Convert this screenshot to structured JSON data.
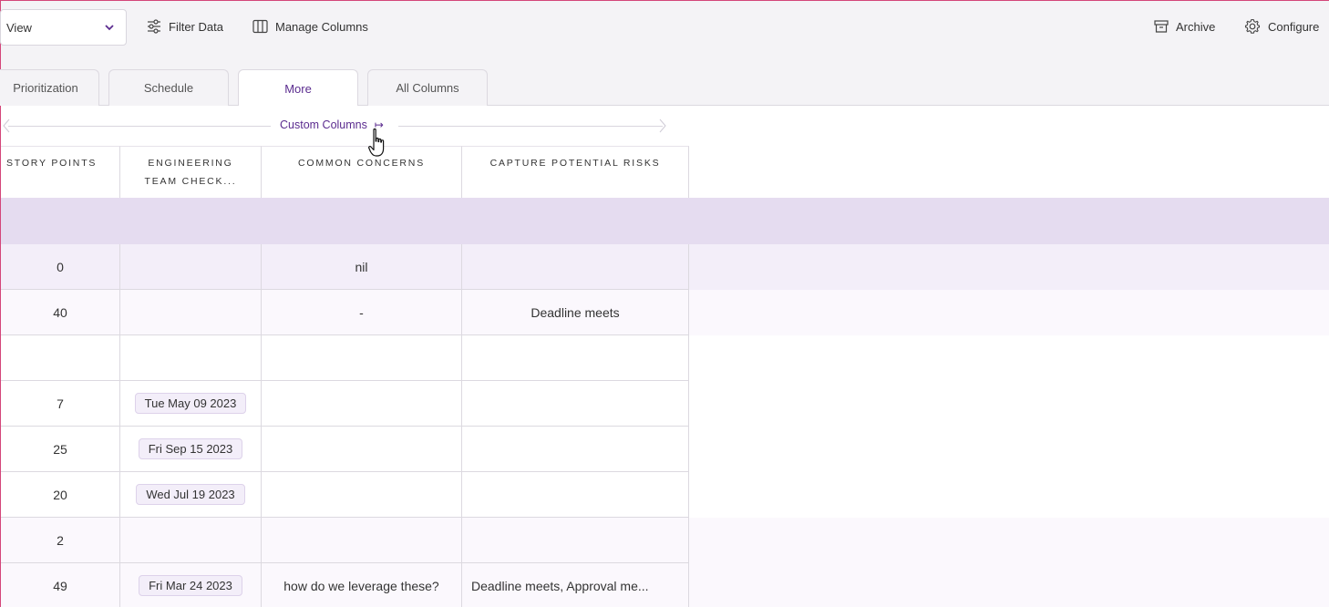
{
  "toolbar": {
    "view_label": "View",
    "filter_label": "Filter Data",
    "manage_label": "Manage Columns",
    "archive_label": "Archive",
    "configure_label": "Configure"
  },
  "tabs": [
    {
      "label": "Prioritization",
      "active": false
    },
    {
      "label": "Schedule",
      "active": false
    },
    {
      "label": "More",
      "active": true
    },
    {
      "label": "All Columns",
      "active": false
    }
  ],
  "group": {
    "label": "Custom Columns",
    "expand_glyph": "↦"
  },
  "columns": [
    {
      "line1": "STORY POINTS",
      "line2": ""
    },
    {
      "line1": "ENGINEERING",
      "line2": "TEAM CHECK..."
    },
    {
      "line1": "COMMON CONCERNS",
      "line2": ""
    },
    {
      "line1": "CAPTURE POTENTIAL RISKS",
      "line2": ""
    }
  ],
  "rows": [
    {
      "points": "0",
      "check": "",
      "concerns": "nil",
      "risks": ""
    },
    {
      "points": "40",
      "check": "",
      "concerns": "-",
      "risks": "Deadline meets"
    },
    {
      "points": "",
      "check": "",
      "concerns": "",
      "risks": ""
    },
    {
      "points": "7",
      "check": "Tue May 09 2023",
      "concerns": "",
      "risks": ""
    },
    {
      "points": "25",
      "check": "Fri Sep 15 2023",
      "concerns": "",
      "risks": ""
    },
    {
      "points": "20",
      "check": "Wed Jul 19 2023",
      "concerns": "",
      "risks": ""
    },
    {
      "points": "2",
      "check": "",
      "concerns": "",
      "risks": ""
    },
    {
      "points": "49",
      "check": "Fri Mar 24 2023",
      "concerns": "how do we leverage these?",
      "risks": "Deadline meets, Approval me..."
    }
  ],
  "colors": {
    "accent": "#5b2c8f",
    "band": "#e5dcf0",
    "border": "#d4467a"
  }
}
